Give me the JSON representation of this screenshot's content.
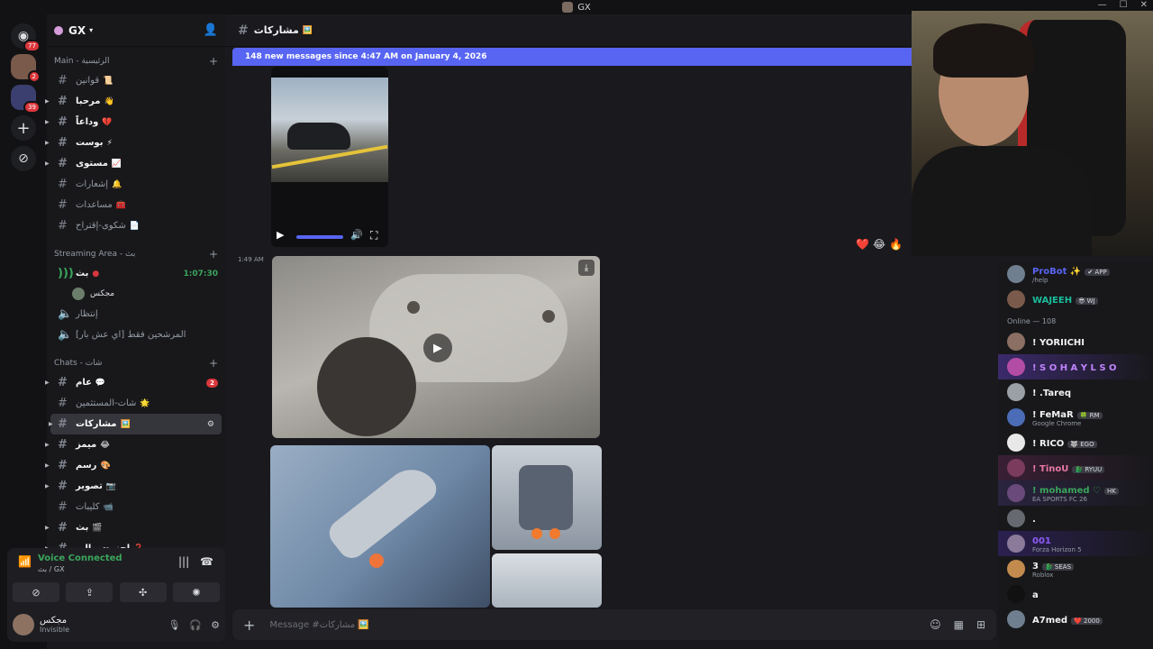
{
  "window": {
    "title": "GX"
  },
  "guilds": {
    "home_badge": "77",
    "server2_badge": "2",
    "server3_badge": "39"
  },
  "server": {
    "name": "GX"
  },
  "sidebar": {
    "categories": [
      {
        "label": "Main - الرئيسية"
      },
      {
        "label": "Streaming Area - بث"
      },
      {
        "label": "Chats - شات"
      }
    ],
    "main_channels": [
      {
        "label": "قوانين",
        "emoji": "📜",
        "unread": false
      },
      {
        "label": "مرحبا",
        "emoji": "👋",
        "unread": true
      },
      {
        "label": "وداعاً",
        "emoji": "💔",
        "unread": true
      },
      {
        "label": "بوست",
        "emoji": "⚡",
        "unread": true
      },
      {
        "label": "مستوى",
        "emoji": "📈",
        "unread": true
      },
      {
        "label": "إشعارات",
        "emoji": "🔔",
        "unread": false
      },
      {
        "label": "مساعدات",
        "emoji": "🧰",
        "unread": false
      },
      {
        "label": "شكوى-إقتراح",
        "emoji": "📄",
        "unread": false
      }
    ],
    "stream_channel": {
      "label": "بث",
      "timer": "1:07:30"
    },
    "stream_user": "مجكس",
    "voice_waiting": "إنتظار",
    "voice_subs": "المرشحين فقط [اي عش بار]",
    "chat_channels": [
      {
        "label": "عام",
        "emoji": "💬",
        "unread": true,
        "badge": "2"
      },
      {
        "label": "شات-المستثمين",
        "emoji": "🌟",
        "unread": false
      },
      {
        "label": "مشاركات",
        "emoji": "🖼️",
        "unread": true,
        "active": true
      },
      {
        "label": "ميمز",
        "emoji": "😂",
        "unread": true
      },
      {
        "label": "رسم",
        "emoji": "🎨",
        "unread": true
      },
      {
        "label": "تصوير",
        "emoji": "📷",
        "unread": true
      },
      {
        "label": "كليبات",
        "emoji": "📹",
        "unread": false
      },
      {
        "label": "بث",
        "emoji": "🎬",
        "unread": true
      },
      {
        "label": "إحزر-سوالي",
        "emoji": "❓",
        "unread": true
      }
    ]
  },
  "voice": {
    "status": "Voice Connected",
    "channel": "بث / GX"
  },
  "user": {
    "name": "مجكس",
    "status": "Invisible"
  },
  "channel": {
    "name": "مشاركات",
    "emoji": "🖼️"
  },
  "new_messages": "148 new messages since 4:47 AM on January 4, 2026",
  "message": {
    "timestamp": "1:49 AM"
  },
  "reactions": [
    "❤️",
    "😂",
    "🔥"
  ],
  "compose": {
    "placeholder": "Message #مشاركات 🖼️"
  },
  "members": {
    "top": [
      {
        "name": "ProBot ✨",
        "tag": "✔ APP",
        "status": "/help",
        "color": "#5865f2"
      },
      {
        "name": "WAJEEH",
        "tag": "😎 WJ",
        "status": "",
        "color": "#1abc9c"
      }
    ],
    "online_header": "Online — 108",
    "online": [
      {
        "name": "! YORIICHI",
        "tag": "",
        "status": "",
        "color": "#f2f3f5",
        "bg": ""
      },
      {
        "name": "! S O H A Y L S O",
        "tag": "",
        "status": "",
        "color": "#c084fc",
        "bg": "#3b2a6b"
      },
      {
        "name": "! .Tareq",
        "tag": "",
        "status": "",
        "color": "#f2f3f5",
        "bg": ""
      },
      {
        "name": "! FeMaR",
        "tag": "🍀 RM",
        "status": "Google Chrome",
        "color": "#f2f3f5",
        "bg": ""
      },
      {
        "name": "! RICO",
        "tag": "🐺 EGO",
        "status": "",
        "color": "#f2f3f5",
        "bg": ""
      },
      {
        "name": "! TinoU",
        "tag": "🐉 RYUU",
        "status": "",
        "color": "#e879a6",
        "bg": "#3a1f35"
      },
      {
        "name": "! mohamed ♡",
        "tag": "HK",
        "status": "EA SPORTS FC 26",
        "color": "#3ba55c",
        "bg": "#2a2440"
      },
      {
        "name": ".",
        "tag": "",
        "status": "",
        "color": "#f2f3f5",
        "bg": ""
      },
      {
        "name": "001",
        "tag": "",
        "status": "Forza Horizon 5",
        "color": "#8b5cf6",
        "bg": "#2b2050"
      },
      {
        "name": "3",
        "tag": "🐉 SEAS",
        "status": "Roblox",
        "color": "#f2f3f5",
        "bg": ""
      },
      {
        "name": "a",
        "tag": "",
        "status": "",
        "color": "#f2f3f5",
        "bg": ""
      },
      {
        "name": "A7med",
        "tag": "❤️ 2000",
        "status": "",
        "color": "#f2f3f5",
        "bg": ""
      }
    ]
  },
  "colors": {
    "accent": "#5865f2",
    "voice_green": "#3ba55c",
    "danger": "#da373c"
  }
}
